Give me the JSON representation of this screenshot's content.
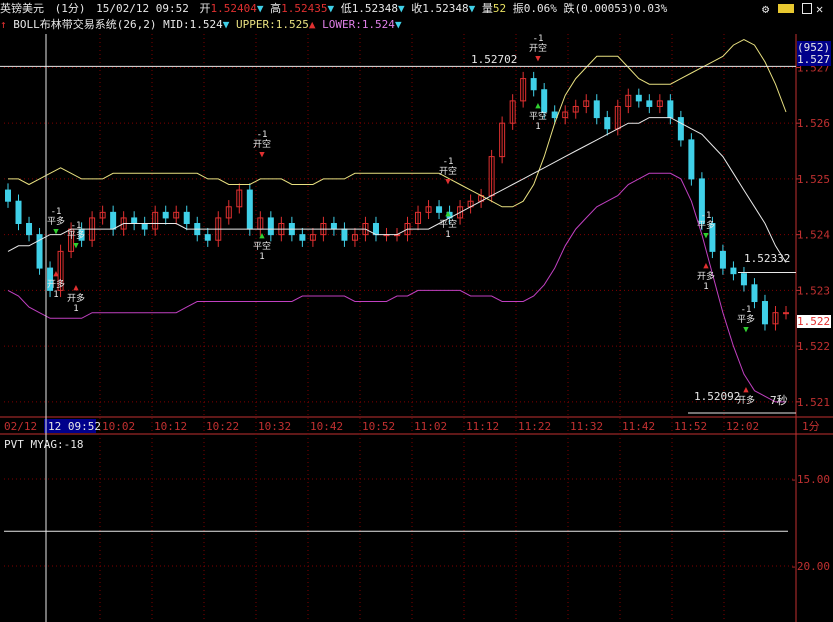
{
  "header": {
    "symbol": "英镑美元",
    "period": "(1分)",
    "datetime": "15/02/12 09:52",
    "open_label": "开",
    "open": "1.52404",
    "high_label": "高",
    "high": "1.52435",
    "low_label": "低",
    "low": "1.52348",
    "close_label": "收",
    "close": "1.52348",
    "vol_label": "量",
    "vol": "52",
    "amp_label": "振",
    "amp": "0.06%",
    "chg_label": "跌",
    "chg": "(0.00053)0.03%"
  },
  "indicator": {
    "name": "BOLL布林带交易系统(26,2)",
    "mid": "MID:1.524",
    "upper": "UPPER:1.525",
    "lower": "LOWER:1.524"
  },
  "sub_indicator": {
    "label": "PVT  MYAG:-18"
  },
  "right_badges": {
    "count": "(952)",
    "price": "1.527",
    "current": "1.522"
  },
  "annotations": {
    "high_price": "1.52702",
    "low_price": "1.52092",
    "recent_high": "1.52332",
    "countdown": "7秒",
    "open_long": "开多",
    "close_long": "平多",
    "open_short": "开空",
    "close_short": "平空",
    "minus_one": "-1",
    "one": "1"
  },
  "colors": {
    "up": "#e03030",
    "down": "#40d0e8",
    "upper": "#e8e080",
    "mid": "#e8e8e8",
    "lower": "#c040c0",
    "grid": "#800000",
    "axis": "#c03030"
  },
  "chart_data": [
    {
      "type": "line",
      "title": "英镑美元 (1分)",
      "y_ticks": [
        1.521,
        1.522,
        1.523,
        1.524,
        1.525,
        1.526,
        1.527
      ],
      "x_ticks": [
        "02/12",
        "12 09:52",
        "10:02",
        "10:12",
        "10:22",
        "10:32",
        "10:42",
        "10:52",
        "11:02",
        "11:12",
        "11:22",
        "11:32",
        "11:42",
        "11:52",
        "12:02",
        "1分"
      ],
      "ylim": [
        1.5208,
        1.5276
      ],
      "series": [
        {
          "name": "UPPER",
          "values": [
            1.525,
            1.525,
            1.5249,
            1.525,
            1.5251,
            1.5252,
            1.5251,
            1.525,
            1.525,
            1.525,
            1.5251,
            1.5251,
            1.5251,
            1.5251,
            1.5251,
            1.5251,
            1.5251,
            1.5251,
            1.5251,
            1.525,
            1.525,
            1.5249,
            1.5249,
            1.5249,
            1.525,
            1.525,
            1.525,
            1.5249,
            1.5249,
            1.5249,
            1.525,
            1.525,
            1.525,
            1.5251,
            1.5251,
            1.5251,
            1.5251,
            1.5251,
            1.5251,
            1.5251,
            1.5251,
            1.5251,
            1.525,
            1.5249,
            1.5248,
            1.5247,
            1.5246,
            1.5245,
            1.5245,
            1.5246,
            1.5249,
            1.5254,
            1.526,
            1.5265,
            1.5268,
            1.527,
            1.5272,
            1.5272,
            1.5272,
            1.527,
            1.5268,
            1.5267,
            1.5267,
            1.5267,
            1.5268,
            1.5269,
            1.527,
            1.5271,
            1.5272,
            1.5274,
            1.5275,
            1.5274,
            1.5271,
            1.5267,
            1.5262
          ]
        },
        {
          "name": "MID",
          "values": [
            1.5237,
            1.5238,
            1.5238,
            1.5239,
            1.524,
            1.524,
            1.5241,
            1.5241,
            1.5241,
            1.5241,
            1.5241,
            1.5242,
            1.5242,
            1.5242,
            1.5242,
            1.5242,
            1.5242,
            1.5241,
            1.5241,
            1.5241,
            1.5241,
            1.5241,
            1.5241,
            1.5241,
            1.5241,
            1.5241,
            1.5241,
            1.5241,
            1.5241,
            1.5241,
            1.5241,
            1.5241,
            1.5241,
            1.5241,
            1.5241,
            1.524,
            1.524,
            1.524,
            1.5241,
            1.5241,
            1.5241,
            1.5242,
            1.5243,
            1.5244,
            1.5245,
            1.5246,
            1.5247,
            1.5248,
            1.5249,
            1.525,
            1.5251,
            1.5252,
            1.5253,
            1.5254,
            1.5255,
            1.5256,
            1.5257,
            1.5258,
            1.5259,
            1.526,
            1.526,
            1.5261,
            1.5261,
            1.5261,
            1.526,
            1.5259,
            1.5258,
            1.5256,
            1.5254,
            1.5251,
            1.5248,
            1.5245,
            1.5242,
            1.5238,
            1.5235
          ]
        },
        {
          "name": "LOWER",
          "values": [
            1.523,
            1.5229,
            1.5227,
            1.5226,
            1.5225,
            1.5225,
            1.5225,
            1.5225,
            1.5226,
            1.5226,
            1.5226,
            1.5226,
            1.5226,
            1.5226,
            1.5226,
            1.5226,
            1.5226,
            1.5227,
            1.5228,
            1.5228,
            1.5228,
            1.5228,
            1.5228,
            1.5228,
            1.5228,
            1.5228,
            1.5228,
            1.5228,
            1.5229,
            1.5229,
            1.5229,
            1.5229,
            1.5229,
            1.5228,
            1.5228,
            1.5228,
            1.5228,
            1.5229,
            1.5229,
            1.523,
            1.523,
            1.523,
            1.523,
            1.523,
            1.5229,
            1.5229,
            1.5229,
            1.5228,
            1.5228,
            1.5228,
            1.5229,
            1.5231,
            1.5234,
            1.5238,
            1.5241,
            1.5243,
            1.5245,
            1.5246,
            1.5247,
            1.5249,
            1.525,
            1.5251,
            1.5251,
            1.5251,
            1.525,
            1.5246,
            1.524,
            1.5233,
            1.5226,
            1.522,
            1.5215,
            1.5212,
            1.5211,
            1.521,
            1.521
          ]
        },
        {
          "name": "CLOSE",
          "values": [
            1.5246,
            1.5242,
            1.524,
            1.5234,
            1.523,
            1.5237,
            1.5241,
            1.5239,
            1.5243,
            1.5244,
            1.5241,
            1.5243,
            1.5242,
            1.5241,
            1.5244,
            1.5243,
            1.5244,
            1.5242,
            1.524,
            1.5239,
            1.5243,
            1.5245,
            1.5248,
            1.5241,
            1.5243,
            1.524,
            1.5242,
            1.524,
            1.5239,
            1.524,
            1.5242,
            1.5241,
            1.5239,
            1.524,
            1.5242,
            1.524,
            1.524,
            1.524,
            1.5242,
            1.5244,
            1.5245,
            1.5244,
            1.5243,
            1.5245,
            1.5246,
            1.5247,
            1.5254,
            1.526,
            1.5264,
            1.5268,
            1.5266,
            1.5262,
            1.5261,
            1.5262,
            1.5263,
            1.5264,
            1.5261,
            1.5259,
            1.5263,
            1.5265,
            1.5264,
            1.5263,
            1.5264,
            1.5261,
            1.5257,
            1.525,
            1.5242,
            1.5237,
            1.5234,
            1.5233,
            1.5231,
            1.5228,
            1.5224,
            1.5226,
            1.5226
          ]
        }
      ]
    },
    {
      "type": "line",
      "title": "PVT",
      "y_ticks": [
        -15.0,
        -20.0
      ],
      "series": [
        {
          "name": "MYAG",
          "values": [
            -18
          ]
        }
      ]
    }
  ]
}
